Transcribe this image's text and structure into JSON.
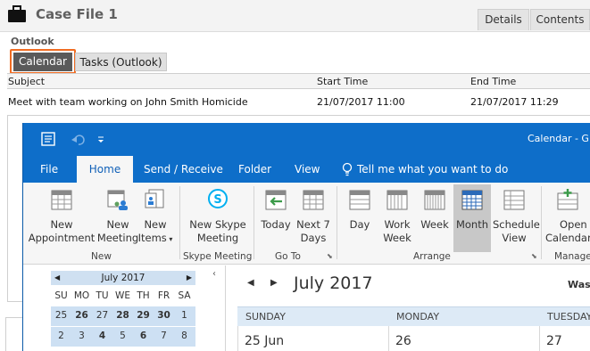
{
  "case": {
    "title": "Case File 1",
    "tabs": [
      "Details",
      "Contents"
    ]
  },
  "outlook_section": {
    "label": "Outlook",
    "tabs": [
      "Calendar",
      "Tasks (Outlook)"
    ]
  },
  "grid": {
    "columns": [
      "Subject",
      "Start Time",
      "End Time"
    ],
    "rows": [
      {
        "subject": "Meet with team working on John Smith Homicide",
        "start": "21/07/2017 11:00",
        "end": "21/07/2017 11:29"
      }
    ]
  },
  "window": {
    "title": "Calendar - G S"
  },
  "menu": {
    "items": [
      "File",
      "Home",
      "Send / Receive",
      "Folder",
      "View"
    ],
    "tell_me": "Tell me what you want to do"
  },
  "ribbon": {
    "new_appointment": [
      "New",
      "Appointment"
    ],
    "new_meeting": [
      "New",
      "Meeting"
    ],
    "new_items": [
      "New",
      "Items"
    ],
    "new_skype_meeting": [
      "New Skype",
      "Meeting"
    ],
    "today": "Today",
    "next7": [
      "Next 7",
      "Days"
    ],
    "day": "Day",
    "work_week": [
      "Work",
      "Week"
    ],
    "week": "Week",
    "month": "Month",
    "schedule_view": [
      "Schedule",
      "View"
    ],
    "open_calendar": [
      "Open",
      "Calendar"
    ],
    "groups": {
      "new": "New",
      "skype": "Skype Meeting",
      "goto": "Go To",
      "arrange": "Arrange",
      "manage": "Manage"
    }
  },
  "mini_calendar": {
    "month": "July 2017",
    "dow": [
      "SU",
      "MO",
      "TU",
      "WE",
      "TH",
      "FR",
      "SA"
    ],
    "weeks": [
      [
        "25",
        "26",
        "27",
        "28",
        "29",
        "30",
        "1"
      ],
      [
        "2",
        "3",
        "4",
        "5",
        "6",
        "7",
        "8"
      ]
    ]
  },
  "calendar": {
    "month": "July 2017",
    "location": "Wash",
    "dow": [
      "SUNDAY",
      "MONDAY",
      "TUESDAY"
    ],
    "days": [
      "25 Jun",
      "26",
      "27"
    ]
  },
  "colors": {
    "outlook_blue": "#0e6ec9",
    "highlight_orange": "#f06c22",
    "mini_cal_blue": "#cde0f3"
  }
}
